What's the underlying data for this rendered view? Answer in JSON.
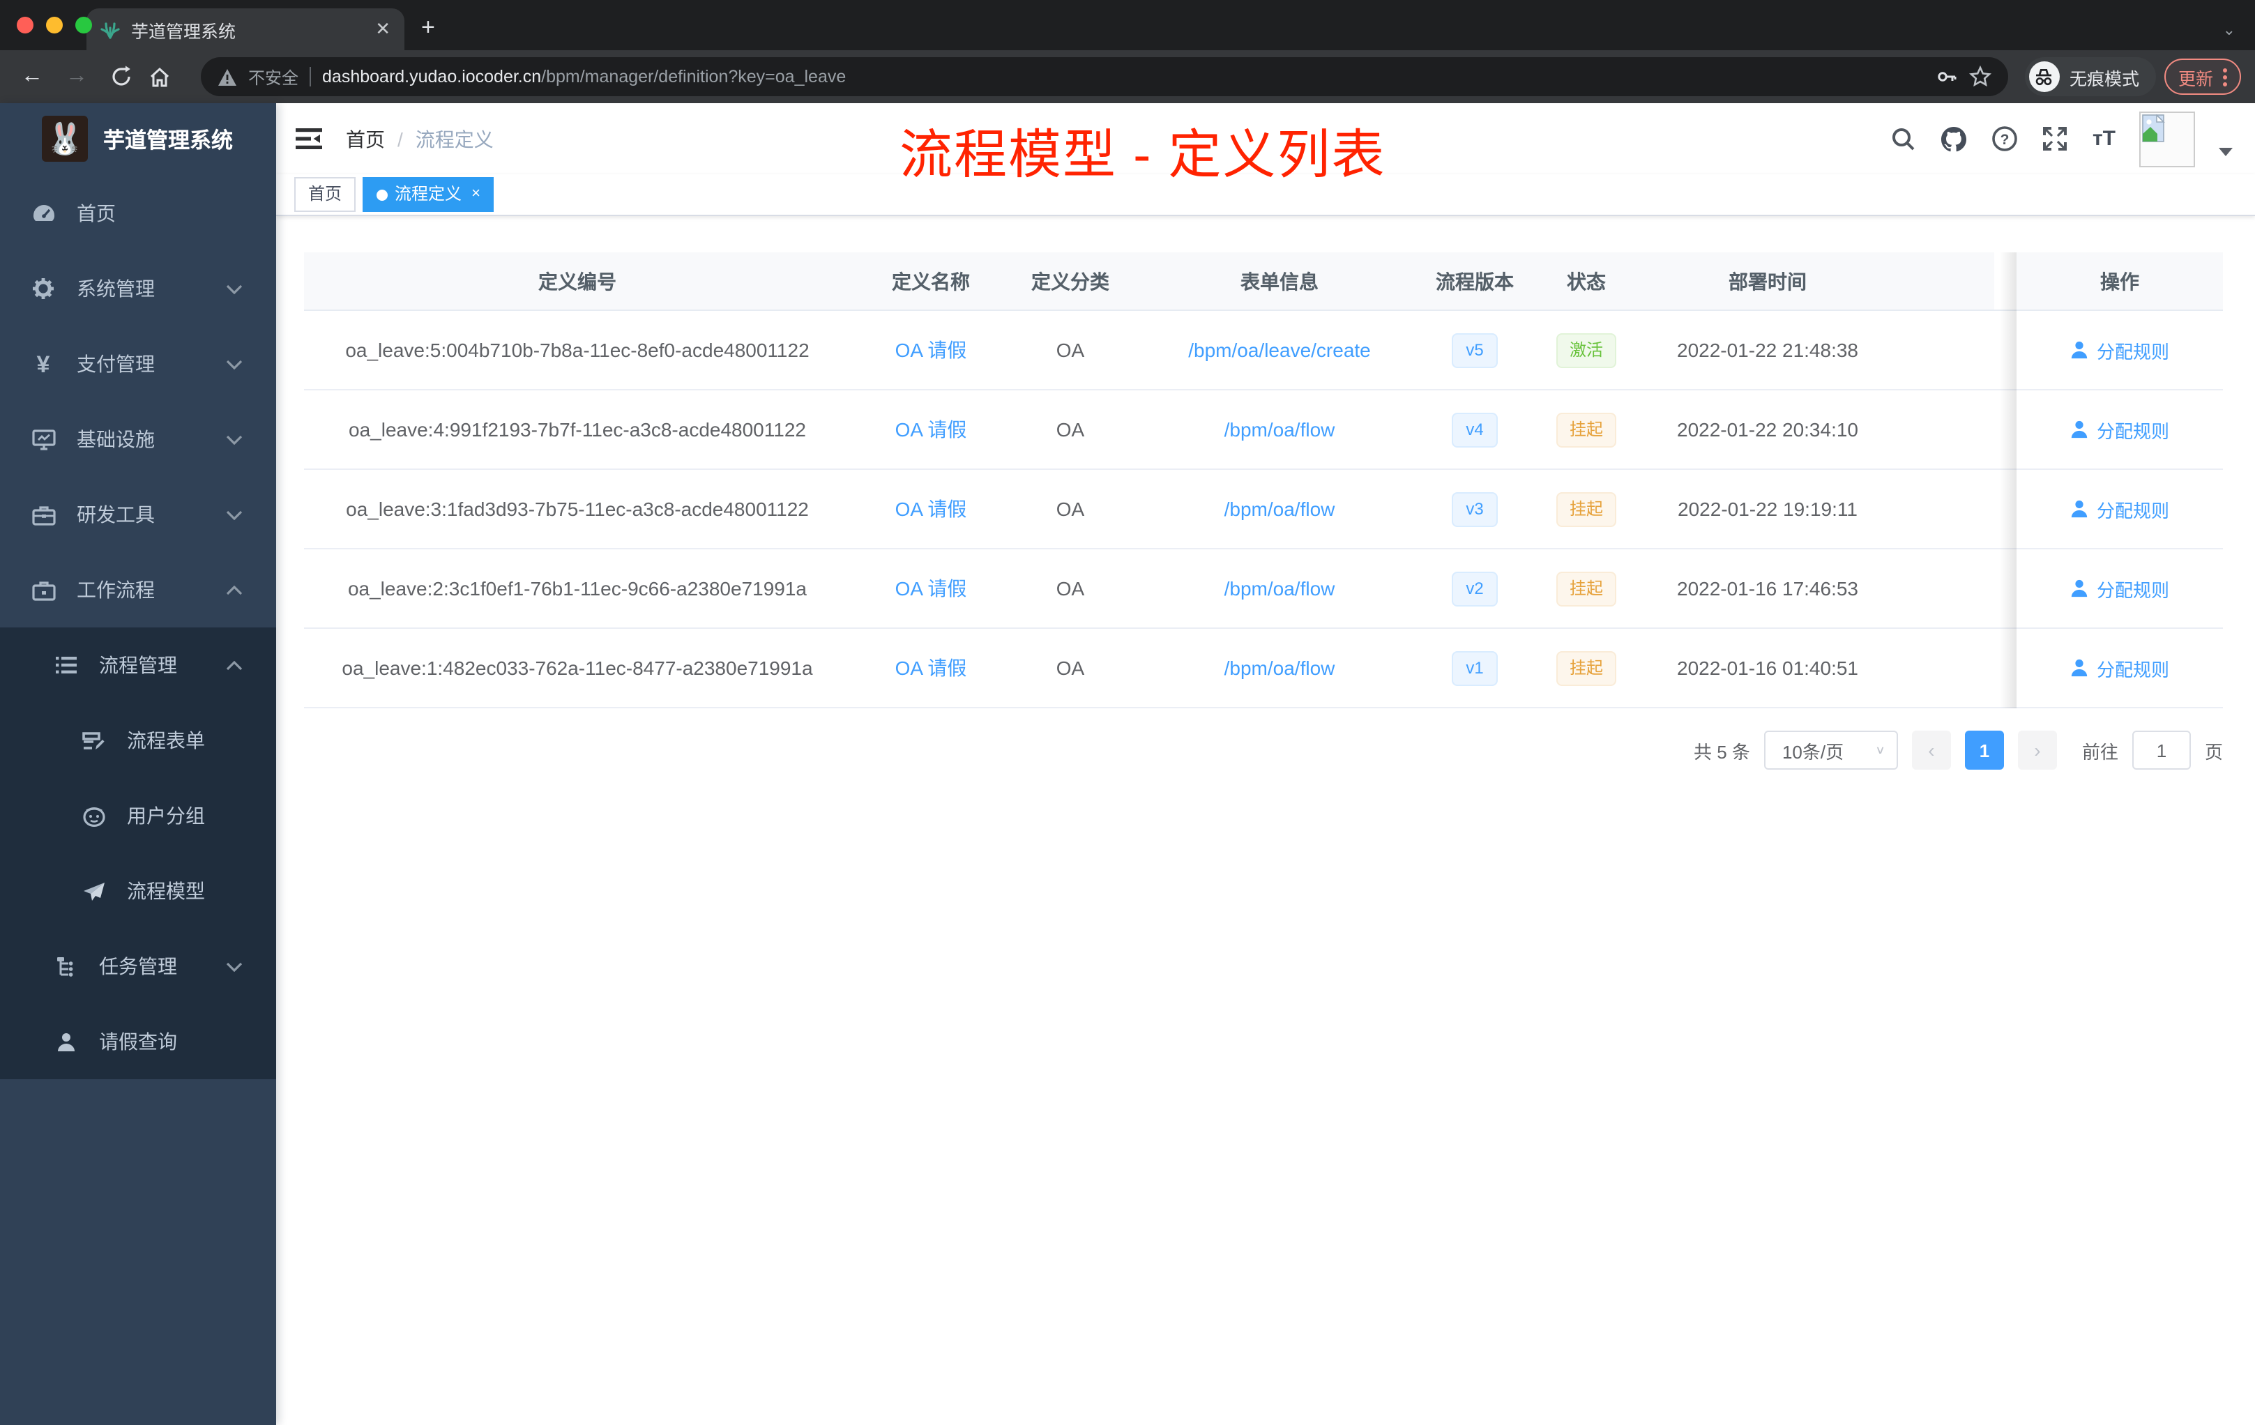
{
  "browser": {
    "tab_title": "芋道管理系统",
    "new_tab": "+",
    "close_tab": "✕",
    "security_label": "不安全",
    "url_host": "dashboard.yudao.iocoder.cn",
    "url_path": "/bpm/manager/definition?key=oa_leave",
    "incognito_label": "无痕模式",
    "update_label": "更新"
  },
  "sidebar": {
    "logo_title": "芋道管理系统",
    "logo_emoji": "🐰",
    "items": [
      {
        "label": "首页",
        "icon": "dashboard-icon",
        "level": 1,
        "chevron": "",
        "submenu": false
      },
      {
        "label": "系统管理",
        "icon": "gear-icon",
        "level": 1,
        "chevron": "down",
        "submenu": false
      },
      {
        "label": "支付管理",
        "icon": "yen-icon",
        "level": 1,
        "chevron": "down",
        "submenu": false
      },
      {
        "label": "基础设施",
        "icon": "monitor-icon",
        "level": 1,
        "chevron": "down",
        "submenu": false
      },
      {
        "label": "研发工具",
        "icon": "toolbox-icon",
        "level": 1,
        "chevron": "down",
        "submenu": false
      },
      {
        "label": "工作流程",
        "icon": "briefcase-icon",
        "level": 1,
        "chevron": "up",
        "submenu": false
      },
      {
        "label": "流程管理",
        "icon": "list-icon",
        "level": 2,
        "chevron": "up",
        "submenu": true
      },
      {
        "label": "流程表单",
        "icon": "form-icon",
        "level": 3,
        "chevron": "",
        "submenu": true
      },
      {
        "label": "用户分组",
        "icon": "robot-icon",
        "level": 3,
        "chevron": "",
        "submenu": true
      },
      {
        "label": "流程模型",
        "icon": "send-icon",
        "level": 3,
        "chevron": "",
        "submenu": true
      },
      {
        "label": "任务管理",
        "icon": "tree-icon",
        "level": 2,
        "chevron": "down",
        "submenu": true
      },
      {
        "label": "请假查询",
        "icon": "user-icon",
        "level": 2,
        "chevron": "",
        "submenu": true
      }
    ]
  },
  "header": {
    "breadcrumb_home": "首页",
    "breadcrumb_sep": "/",
    "breadcrumb_current": "流程定义",
    "overlay_title": "流程模型 - 定义列表"
  },
  "tags": {
    "home": "首页",
    "active": "流程定义",
    "close": "×"
  },
  "table": {
    "columns": [
      "定义编号",
      "定义名称",
      "定义分类",
      "表单信息",
      "流程版本",
      "状态",
      "部署时间",
      "操作"
    ],
    "action_label": "分配规则",
    "rows": [
      {
        "id": "oa_leave:5:004b710b-7b8a-11ec-8ef0-acde48001122",
        "name": "OA 请假",
        "category": "OA",
        "form": "/bpm/oa/leave/create",
        "version": "v5",
        "status": "激活",
        "status_type": "success",
        "time": "2022-01-22 21:48:38"
      },
      {
        "id": "oa_leave:4:991f2193-7b7f-11ec-a3c8-acde48001122",
        "name": "OA 请假",
        "category": "OA",
        "form": "/bpm/oa/flow",
        "version": "v4",
        "status": "挂起",
        "status_type": "warning",
        "time": "2022-01-22 20:34:10"
      },
      {
        "id": "oa_leave:3:1fad3d93-7b75-11ec-a3c8-acde48001122",
        "name": "OA 请假",
        "category": "OA",
        "form": "/bpm/oa/flow",
        "version": "v3",
        "status": "挂起",
        "status_type": "warning",
        "time": "2022-01-22 19:19:11"
      },
      {
        "id": "oa_leave:2:3c1f0ef1-76b1-11ec-9c66-a2380e71991a",
        "name": "OA 请假",
        "category": "OA",
        "form": "/bpm/oa/flow",
        "version": "v2",
        "status": "挂起",
        "status_type": "warning",
        "time": "2022-01-16 17:46:53"
      },
      {
        "id": "oa_leave:1:482ec033-762a-11ec-8477-a2380e71991a",
        "name": "OA 请假",
        "category": "OA",
        "form": "/bpm/oa/flow",
        "version": "v1",
        "status": "挂起",
        "status_type": "warning",
        "time": "2022-01-16 01:40:51"
      }
    ]
  },
  "pagination": {
    "total": "共 5 条",
    "page_size": "10条/页",
    "prev": "‹",
    "current": "1",
    "next": "›",
    "goto": "前往",
    "goto_value": "1",
    "unit": "页"
  },
  "colors": {
    "accent": "#409eff",
    "active_tag": "#2d9cf3",
    "overlay_red": "#ff2301",
    "sidebar_bg": "#304156",
    "submenu_bg": "#1f2d3d",
    "success": "#67c23a",
    "warning": "#e6a23c",
    "traffic_red": "#ff5f57",
    "traffic_yellow": "#febc2e",
    "traffic_green": "#28c840"
  }
}
